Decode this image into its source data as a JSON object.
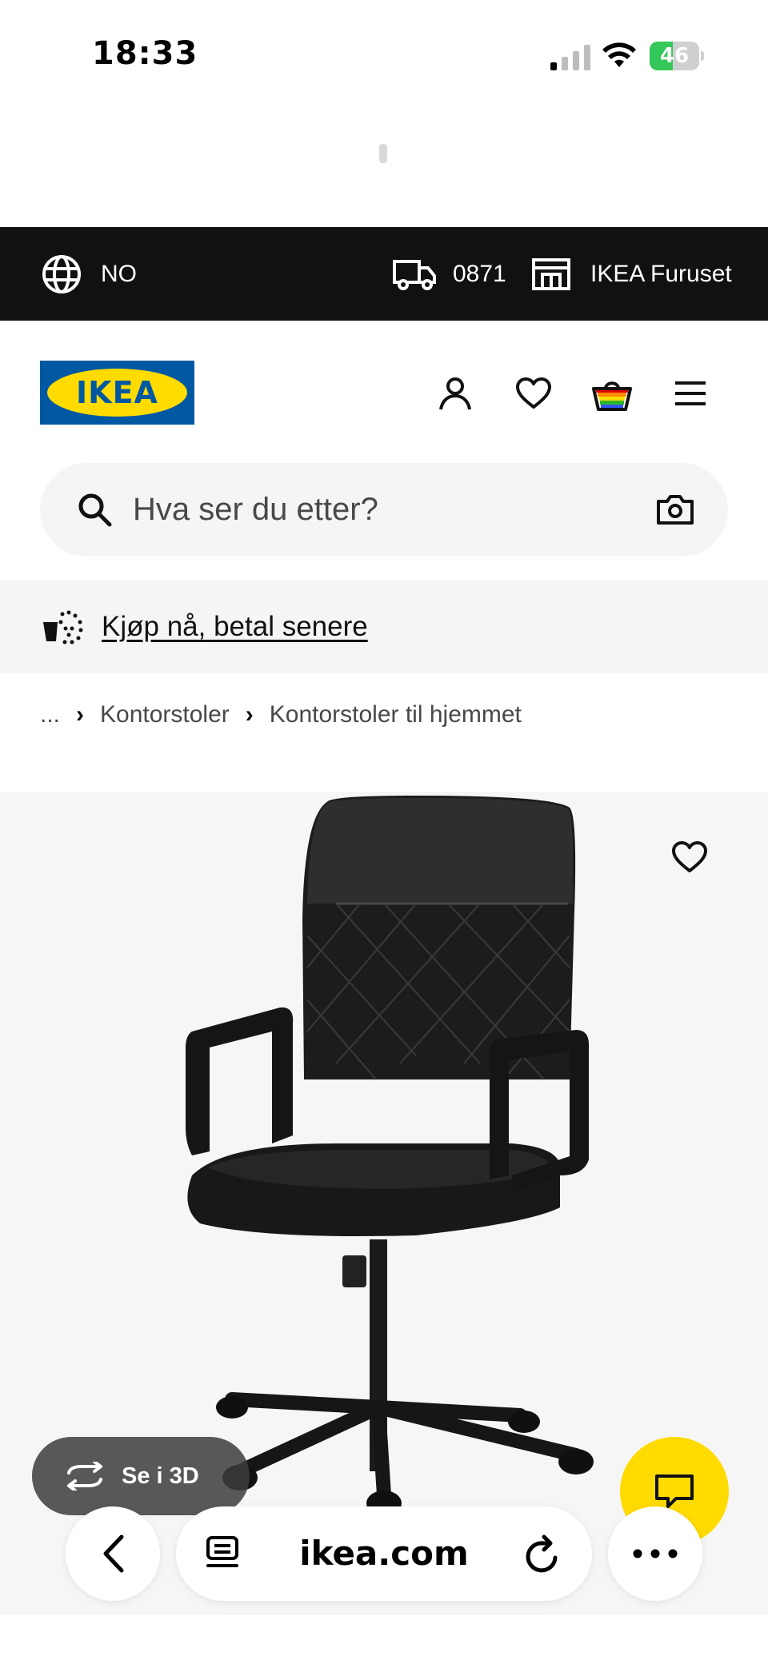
{
  "status_bar": {
    "time": "18:33",
    "battery_level": "46",
    "battery_fraction": 0.46
  },
  "top_bar": {
    "language": "NO",
    "postcode": "0871",
    "store": "IKEA Furuset"
  },
  "header": {
    "logo_text": "IKEA",
    "icons": [
      "profile-icon",
      "heart-icon",
      "basket-icon",
      "menu-icon"
    ]
  },
  "search": {
    "placeholder": "Hva ser du etter?"
  },
  "promo": {
    "link_text": "Kjøp nå, betal senere"
  },
  "breadcrumb": {
    "ellipsis": "...",
    "items": [
      "Kontorstoler",
      "Kontorstoler til hjemmet"
    ]
  },
  "product": {
    "see_3d_label": "Se i 3D"
  },
  "browser": {
    "url": "ikea.com"
  },
  "colors": {
    "ikea_blue": "#0058a3",
    "ikea_yellow": "#ffdb00",
    "top_bar_bg": "#111111",
    "battery_green": "#34c759"
  }
}
